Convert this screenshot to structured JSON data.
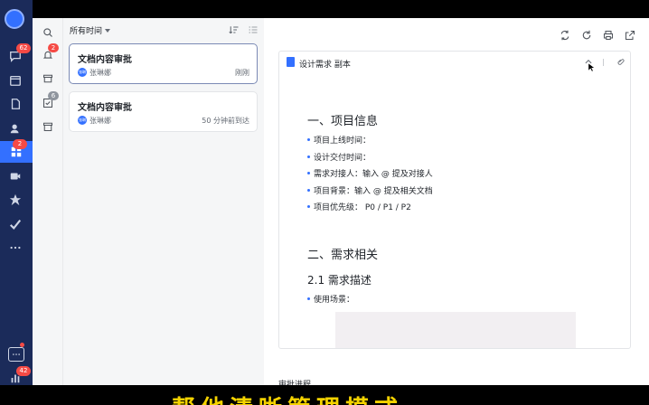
{
  "rail": {
    "badges": {
      "docs": "62",
      "apps": "2",
      "more": "",
      "bottom": "42"
    }
  },
  "sidebar2": {
    "badges": {
      "todo": "2",
      "done": "6"
    }
  },
  "list": {
    "filter_label": "所有时间",
    "cards": [
      {
        "title": "文档内容审批",
        "avatar": "张琳",
        "name": "张琳娜",
        "time": "刚刚"
      },
      {
        "title": "文档内容审批",
        "avatar": "张琳",
        "name": "张琳娜",
        "time": "50 分钟前到达"
      }
    ]
  },
  "doc": {
    "title": "设计需求 副本",
    "section1": {
      "heading": "一、项目信息",
      "items": [
        "项目上线时间：",
        "设计交付时间：",
        "需求对接人：输入 @ 提及对接人",
        "项目背景：输入 @ 提及相关文档",
        "项目优先级：   P0 / P1 / P2"
      ]
    },
    "section2": {
      "heading": "二、需求相关",
      "subheading": "2.1  需求描述",
      "items": [
        "使用场景："
      ]
    }
  },
  "footer": {
    "label": "审批进程"
  },
  "caption": "帮他清晰管理模式",
  "colors": {
    "rail": "#1b2b5a",
    "accent": "#3370ff",
    "badge": "#f54a45",
    "caption": "#f5d300"
  }
}
